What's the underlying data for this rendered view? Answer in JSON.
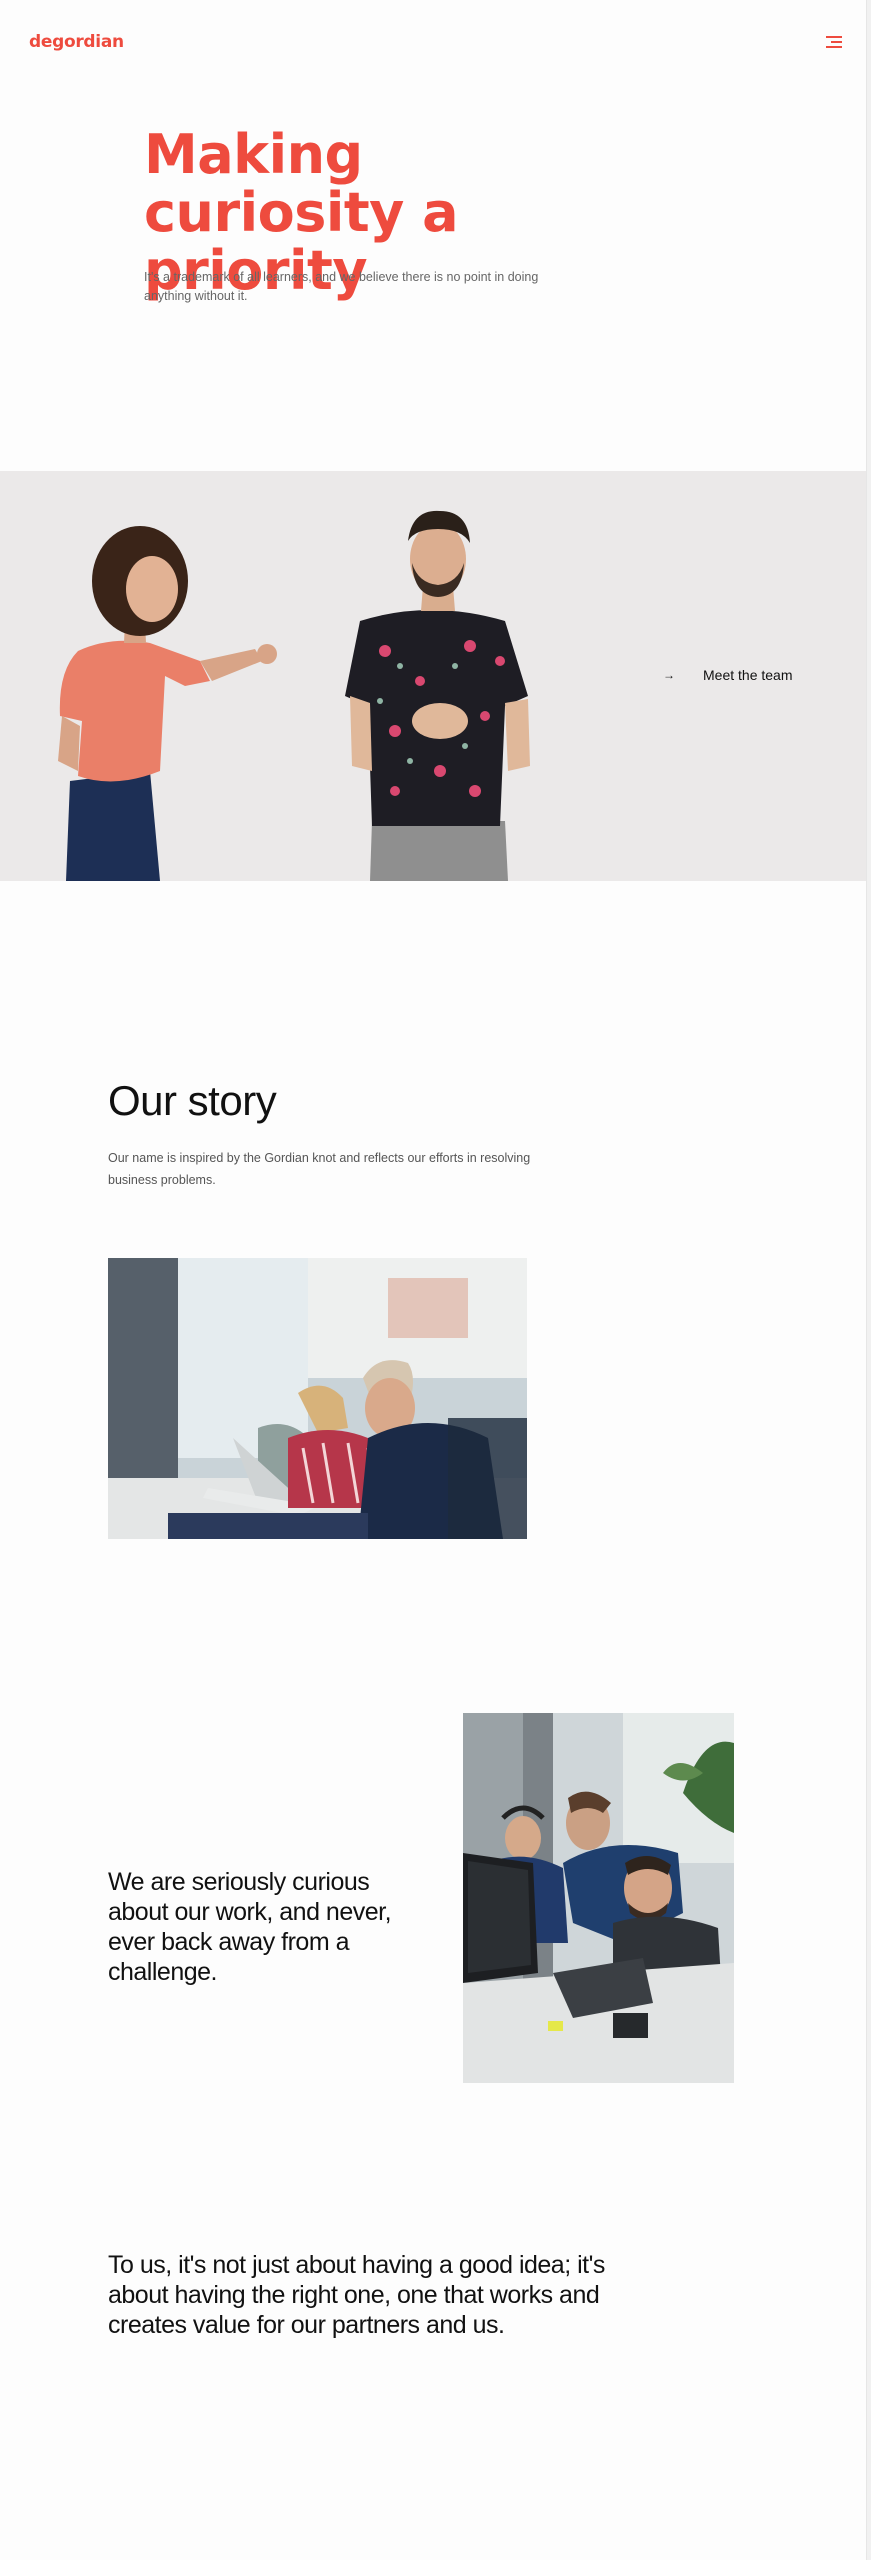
{
  "header": {
    "logo_text": "degordian",
    "menu_icon": "hamburger-menu-icon"
  },
  "hero": {
    "title": "Making curiosity a priority",
    "subtitle": "It's a trademark of all learners, and we believe there is no point in doing anything without it."
  },
  "team": {
    "link_arrow": "→",
    "link_label": "Meet the team"
  },
  "story": {
    "title": "Our story",
    "text": "Our name is inspired by the Gordian knot and reflects our efforts in resolving business problems."
  },
  "quotes": {
    "curious": "We are seriously curious about our work, and never, ever back away from a challenge.",
    "idea": "To us, it's not just about having a good idea; it's about having the right one, one that works and creates value for our partners and us."
  },
  "colors": {
    "brand": "#ee4b3e",
    "band_background": "#ebe9e9"
  }
}
